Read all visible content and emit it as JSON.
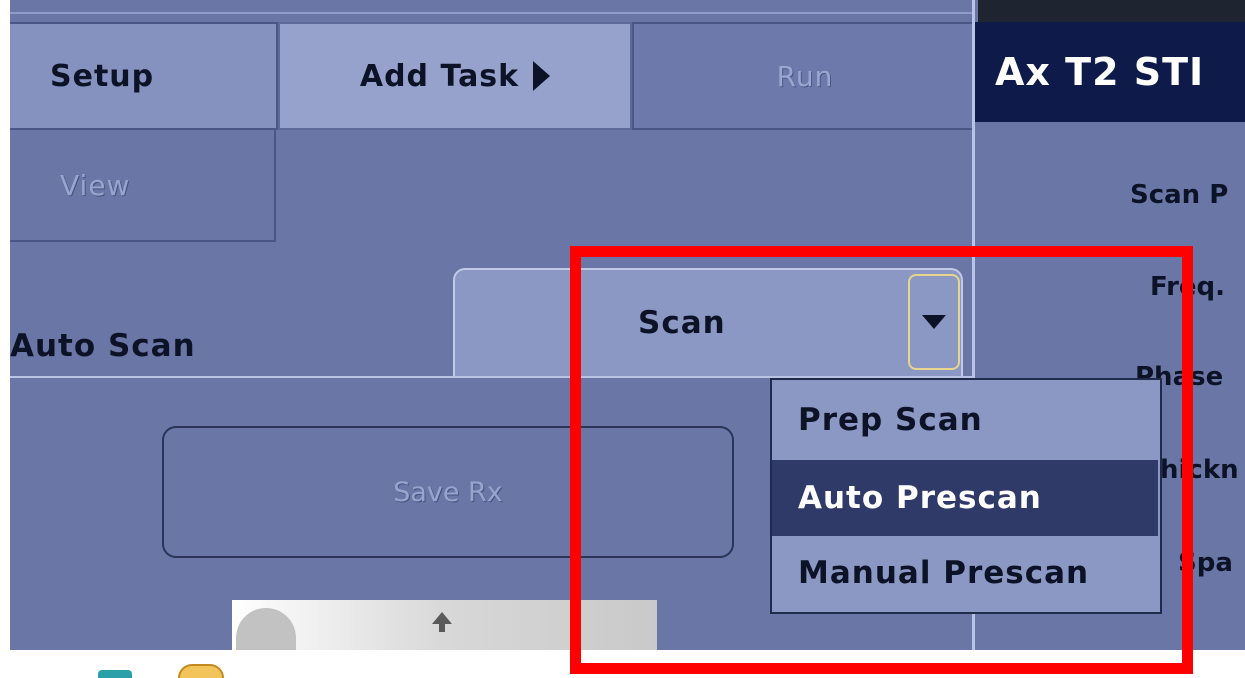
{
  "toolbar": {
    "setup_label": "Setup",
    "add_task_label": "Add Task",
    "run_label": "Run",
    "view_label": "View"
  },
  "auto_scan": {
    "label": "Auto Scan",
    "scan_select_value": "Scan",
    "menu_items": [
      "Prep Scan",
      "Auto Prescan",
      "Manual Prescan"
    ],
    "highlighted_item": "Auto Prescan"
  },
  "save_rx_label": "Save Rx",
  "protocol_panel": {
    "title": "Ax T2 STI",
    "labels": [
      "Scan P",
      "Freq.",
      "Phase",
      "hickn",
      "Spa"
    ]
  },
  "colors": {
    "background": "#6a77a6",
    "highlight": "#303a68",
    "annotation_box": "#ff0000",
    "focus_outline": "#e8d48a"
  },
  "icons": {
    "add_task": "caret-right-icon",
    "dropdown": "caret-down-icon",
    "thumbnail_arrow": "arrow-up-icon"
  }
}
